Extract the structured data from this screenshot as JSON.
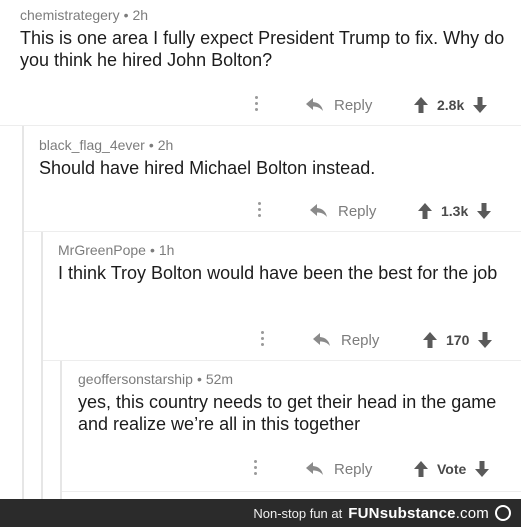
{
  "comments": [
    {
      "username": "chemistrategery",
      "age": "2h",
      "text": "This is one area I fully expect President Trump to fix. Why do you think he hired John Bolton?",
      "reply_label": "Reply",
      "score": "2.8k"
    },
    {
      "username": "black_flag_4ever",
      "age": "2h",
      "text": "Should have hired Michael Bolton instead.",
      "reply_label": "Reply",
      "score": "1.3k"
    },
    {
      "username": "MrGreenPope",
      "age": "1h",
      "text": "I think Troy Bolton would have been the best for the job",
      "reply_label": "Reply",
      "score": "170"
    },
    {
      "username": "geoffersonstarship",
      "age": "52m",
      "text": "yes, this country needs to get their head in the game and realize we’re all in this together",
      "reply_label": "Reply",
      "score": "Vote"
    }
  ],
  "footer": {
    "tagline": "Non-stop fun at",
    "brand_bold": "FUN",
    "brand_rest": "substance",
    "brand_tld": ".com"
  },
  "colors": {
    "meta_text": "#7c7c7c",
    "footer_bg": "#2b2b2b",
    "thread_line": "#e6e6e6"
  },
  "icons": [
    "kebab-menu-icon",
    "reply-arrow-icon",
    "upvote-arrow-icon",
    "downvote-arrow-icon",
    "funsubstance-face-icon"
  ]
}
